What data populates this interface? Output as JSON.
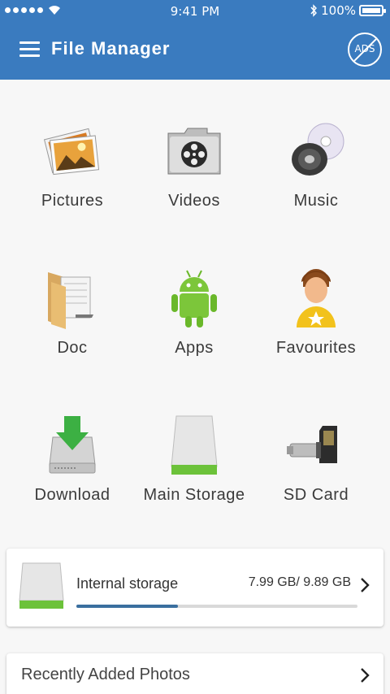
{
  "status_bar": {
    "time": "9:41 PM",
    "battery": "100%",
    "wifi_icon": "wifi-icon",
    "bluetooth_icon": "bluetooth-icon"
  },
  "app_bar": {
    "title": "File Manager",
    "menu_icon": "hamburger-menu-icon",
    "ads_label": "ADS",
    "ads_icon": "no-ads-icon",
    "color": "#3a7bbf"
  },
  "categories": [
    {
      "label": "Pictures",
      "icon": "pictures-icon"
    },
    {
      "label": "Videos",
      "icon": "videos-icon"
    },
    {
      "label": "Music",
      "icon": "music-icon"
    },
    {
      "label": "Doc",
      "icon": "doc-folder-icon"
    },
    {
      "label": "Apps",
      "icon": "android-apps-icon"
    },
    {
      "label": "Favourites",
      "icon": "favourites-user-icon"
    },
    {
      "label": "Download",
      "icon": "download-drive-icon"
    },
    {
      "label": "Main Storage",
      "icon": "main-storage-drive-icon"
    },
    {
      "label": "SD Card",
      "icon": "sd-card-icon"
    }
  ],
  "storage": {
    "label": "Internal storage",
    "size": "7.99 GB/ 9.89 GB",
    "used_fraction": 0.36,
    "icon": "drive-icon",
    "progress_color": "#3a6f9f"
  },
  "recent": {
    "label": "Recently Added Photos",
    "icon": "chevron-right-icon"
  }
}
